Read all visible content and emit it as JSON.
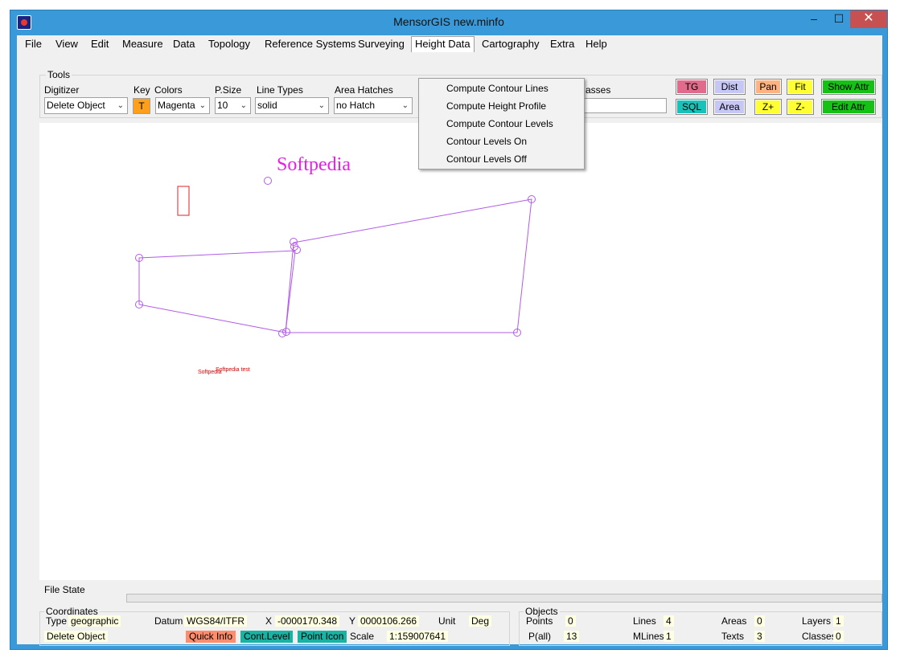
{
  "window": {
    "title": "MensorGIS new.minfo",
    "min": "–",
    "max": "☐",
    "close": "✕"
  },
  "menu": [
    "File",
    "View",
    "Edit",
    "Measure",
    "Data",
    "Topology",
    "Reference Systems",
    "Surveying",
    "Height Data",
    "Cartography",
    "Extra",
    "Help"
  ],
  "tools": {
    "group_label": "Tools",
    "digitizer_label": "Digitizer",
    "digitizer_value": "Delete Object",
    "key_label": "Key",
    "key_value": "T",
    "colors_label": "Colors",
    "colors_value": "Magenta",
    "psize_label": "P.Size",
    "psize_value": "10",
    "linetypes_label": "Line Types",
    "linetypes_value": "solid",
    "hatches_label": "Area Hatches",
    "hatches_value": "no Hatch",
    "classes_label": "asses"
  },
  "buttons": {
    "tg": "TG",
    "sql": "SQL",
    "dist": "Dist",
    "area": "Area",
    "pan": "Pan",
    "zoom_in": "Z+",
    "fit": "Fit",
    "zoom_out": "Z-",
    "show_attr": "Show Attr",
    "edit_attr": "Edit Attr"
  },
  "height_menu": [
    "Compute Contour Lines",
    "Compute Height Profile",
    "Compute Contour Levels",
    "Contour Levels On",
    "Contour Levels Off"
  ],
  "map": {
    "label_big": "Softpedia",
    "label_small_1": "Softpedia",
    "label_small_2": "Softpedia test",
    "line_color": "#b05ce6",
    "rect_color": "#e02020"
  },
  "status": {
    "file_state": "File State",
    "coords_label": "Coordinates",
    "type_label": "Type",
    "type_value": "geographic",
    "datum_label": "Datum",
    "datum_value": "WGS84/ITFR",
    "x_label": "X",
    "x_value": "-0000170.348",
    "y_label": "Y",
    "y_value": "0000106.266",
    "unit_label": "Unit",
    "unit_value": "Deg",
    "mode_value": "Delete Object",
    "quick_info": "Quick Info",
    "cont_level": "Cont.Level",
    "point_icon": "Point Icon",
    "scale_label": "Scale",
    "scale_value": "1:159007641"
  },
  "objects": {
    "label": "Objects",
    "points_label": "Points",
    "points": "0",
    "pall_label": "P(all)",
    "pall": "13",
    "lines_label": "Lines",
    "lines": "4",
    "mlines_label": "MLines",
    "mlines": "1",
    "areas_label": "Areas",
    "areas": "0",
    "texts_label": "Texts",
    "texts": "3",
    "layers_label": "Layers",
    "layers": "1",
    "classes_label": "Classes",
    "classes": "0"
  }
}
